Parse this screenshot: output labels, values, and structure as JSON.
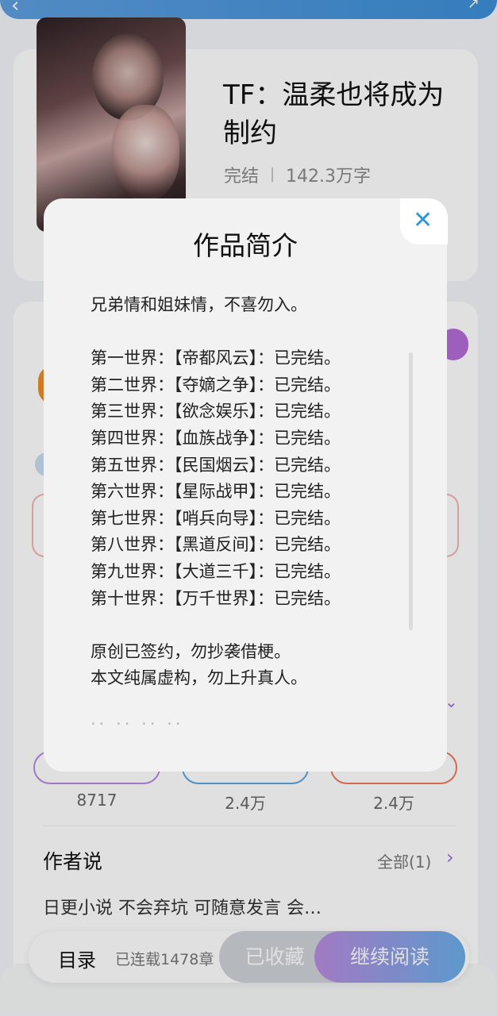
{
  "book": {
    "title": "TF：温柔也将成为制约",
    "status": "完结",
    "word_count": "142.3万字"
  },
  "stats": {
    "values": [
      "8717",
      "2.4万",
      "2.4万"
    ]
  },
  "author_notes": {
    "label": "作者说",
    "all_label": "全部(1)",
    "text": "日更小说 不会弃坑 可随意发言 会…"
  },
  "bottom_bar": {
    "toc_label": "目录",
    "toc_count": "已连载1478章",
    "favorite_label": "已收藏",
    "continue_label": "继续阅读"
  },
  "modal": {
    "title": "作品简介",
    "intro_line": "兄弟情和姐妹情，不喜勿入。",
    "worlds": [
      "第一世界：【帝都风云】：已完结。",
      "第二世界：【夺嫡之争】：已完结。",
      "第三世界：【欲念娱乐】：已完结。",
      "第四世界：【血族战争】：已完结。",
      "第五世界：【民国烟云】：已完结。",
      "第六世界：【星际战甲】：已完结。",
      "第七世界：【哨兵向导】：已完结。",
      "第八世界：【黑道反间】：已完结。",
      "第九世界：【大道三千】：已完结。",
      "第十世界：【万千世界】：已完结。"
    ],
    "note_1": "原创已签约，勿抄袭借梗。",
    "note_2": "本文纯属虚构，勿上升真人。",
    "close_icon": "close-icon"
  },
  "colors": {
    "accent_blue": "#2e97e0",
    "accent_purple": "#9b6ad6",
    "gradient_start": "#b98ce0",
    "gradient_end": "#6aaee8"
  }
}
